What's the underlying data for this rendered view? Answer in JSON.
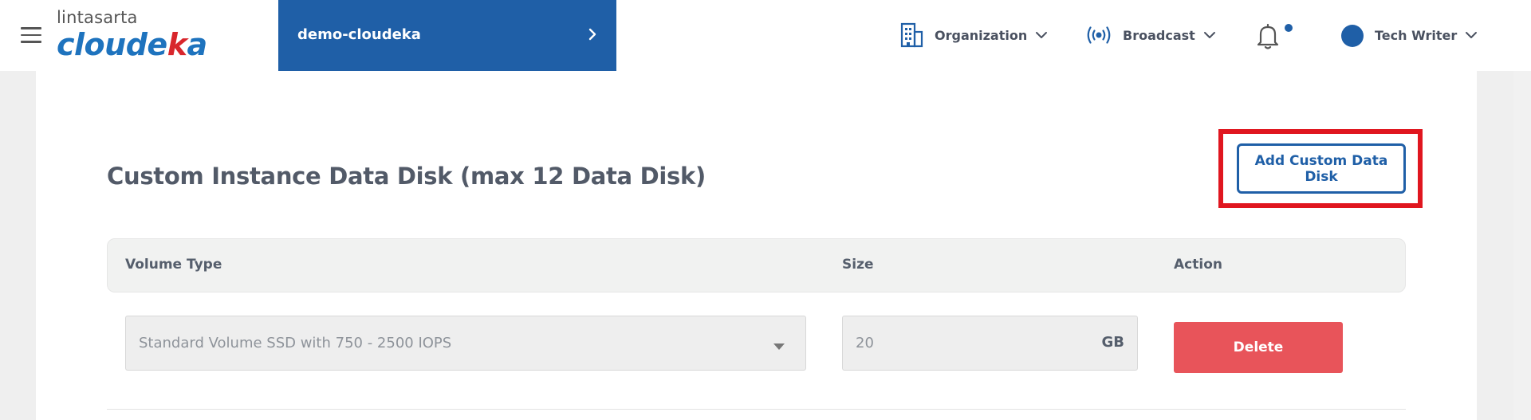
{
  "header": {
    "logo_top": "lintasarta",
    "logo_main_a": "cloude",
    "logo_main_b": "k",
    "logo_main_c": "a",
    "project_name": "demo-cloudeka",
    "nav": {
      "organization": "Organization",
      "broadcast": "Broadcast",
      "user": "Tech Writer"
    },
    "has_notification": true
  },
  "section": {
    "title": "Custom Instance Data Disk (max 12 Data Disk)",
    "add_button": "Add Custom Data Disk"
  },
  "table": {
    "columns": [
      "Volume Type",
      "Size",
      "Action"
    ],
    "rows": [
      {
        "volume_type": "Standard Volume SSD with 750 - 2500 IOPS",
        "size": "20",
        "unit": "GB",
        "action": "Delete"
      }
    ]
  },
  "colors": {
    "brand_blue": "#1f5fa7",
    "highlight_red": "#e0161f",
    "delete_red": "#e8545a"
  }
}
